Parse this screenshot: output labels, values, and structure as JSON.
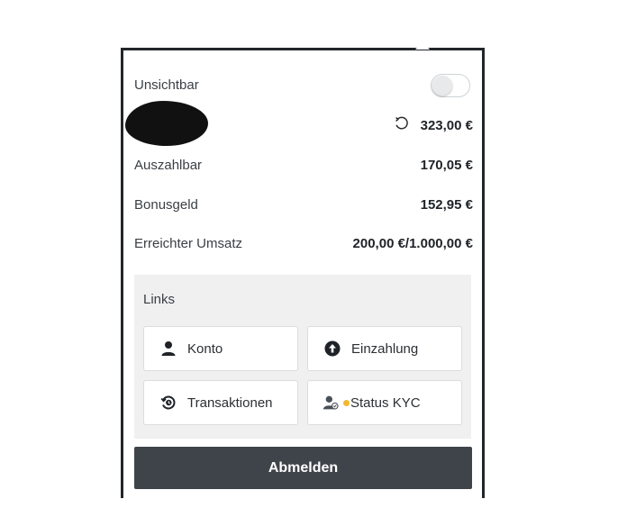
{
  "visibility": {
    "label": "Unsichtbar",
    "toggle_on": false
  },
  "balance": {
    "value": "323,00 €"
  },
  "rows": [
    {
      "label": "Auszahlbar",
      "value": "170,05 €"
    },
    {
      "label": "Bonusgeld",
      "value": "152,95 €"
    },
    {
      "label": "Erreichter Umsatz",
      "value": "200,00 €/1.000,00 €"
    }
  ],
  "links": {
    "title": "Links",
    "items": [
      {
        "label": "Konto",
        "icon": "user-icon"
      },
      {
        "label": "Einzahlung",
        "icon": "arrow-up-circle-icon"
      },
      {
        "label": "Transaktionen",
        "icon": "history-icon"
      },
      {
        "label": "Status KYC",
        "icon": "user-verify-icon"
      }
    ]
  },
  "logout": {
    "label": "Abmelden"
  },
  "colors": {
    "button": "#3e444a",
    "kyc_dot": "#f2b82d",
    "links_bg": "#f0f0f0"
  }
}
